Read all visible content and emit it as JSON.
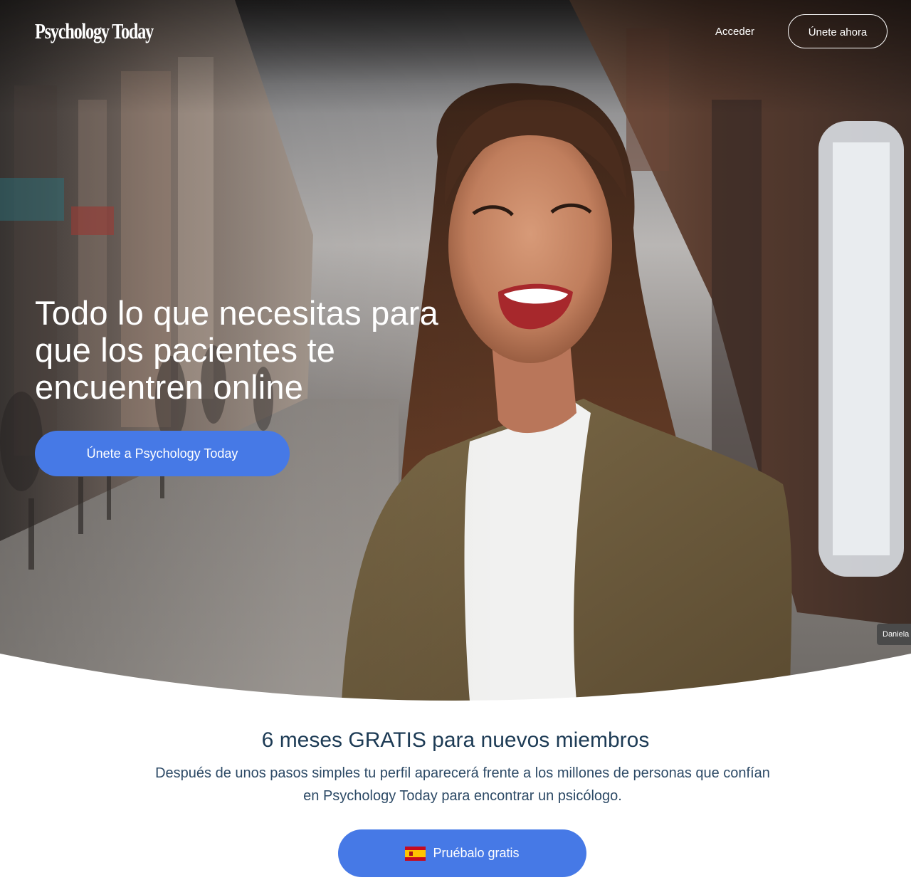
{
  "header": {
    "logo_text": "Psychology Today",
    "login_label": "Acceder",
    "join_label": "Únete ahora"
  },
  "hero": {
    "title": "Todo lo que necesitas para que los pacientes te encuentren online",
    "cta_label": "Únete a Psychology Today",
    "photo_credit": "Daniela",
    "image_description": "smiling-woman-on-city-street"
  },
  "promo": {
    "title": "6 meses GRATIS para nuevos miembros",
    "description": "Después de unos pasos simples tu perfil aparecerá frente a los millones de personas que confían en Psychology Today para encontrar un psicólogo.",
    "cta_label": "Pruébalo gratis",
    "cta_icon": "spain-flag-icon"
  },
  "colors": {
    "accent": "#4679e6",
    "heading": "#1d3b55",
    "body_text": "#2d4a66"
  }
}
